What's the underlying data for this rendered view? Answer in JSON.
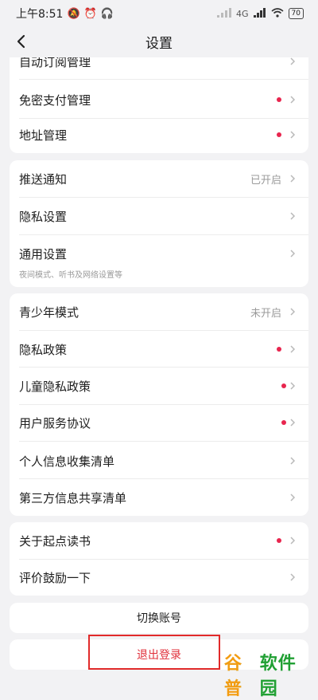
{
  "status_bar": {
    "time": "上午8:51",
    "network": "4G",
    "battery": "70"
  },
  "header": {
    "title": "设置"
  },
  "card1": {
    "items": [
      {
        "label": "自动订阅管理"
      },
      {
        "label": "免密支付管理"
      },
      {
        "label": "地址管理"
      }
    ]
  },
  "card2": {
    "items": [
      {
        "label": "推送通知",
        "status": "已开启"
      },
      {
        "label": "隐私设置"
      },
      {
        "label": "通用设置",
        "sub": "夜间模式、听书及网络设置等"
      }
    ]
  },
  "card3": {
    "items": [
      {
        "label": "青少年模式",
        "status": "未开启"
      },
      {
        "label": "隐私政策"
      },
      {
        "label": "儿童隐私政策"
      },
      {
        "label": "用户服务协议"
      },
      {
        "label": "个人信息收集清单"
      },
      {
        "label": "第三方信息共享清单"
      }
    ]
  },
  "card4": {
    "items": [
      {
        "label": "关于起点读书"
      },
      {
        "label": "评价鼓励一下"
      }
    ]
  },
  "actions": {
    "switch_account": "切换账号",
    "logout": "退出登录"
  },
  "watermark": {
    "part1": "谷普",
    "part2": "软件园"
  },
  "colors": {
    "dot": "#e8254e",
    "logout": "#e0303b",
    "highlight_border": "#e12a2a"
  }
}
